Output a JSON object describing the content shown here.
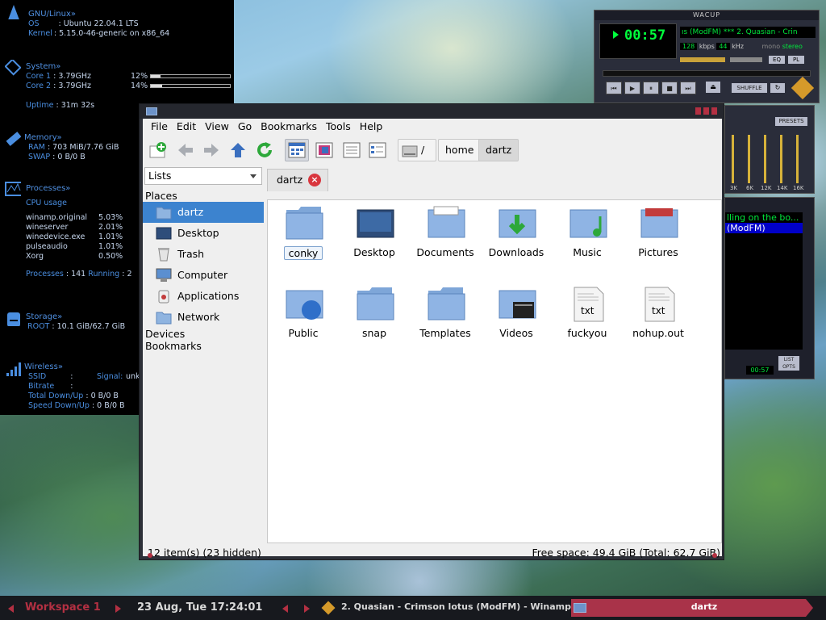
{
  "conky": {
    "sys_header": "GNU/Linux»",
    "os_key": "OS",
    "os_val": ": Ubuntu 22.04.1 LTS",
    "kernel_key": "Kernel",
    "kernel_val": ": 5.15.0-46-generic on x86_64",
    "system_header": "System»",
    "core1_label": "Core 1",
    "core1_val": ": 3.79GHz",
    "core1_pct": "12%",
    "core1_frac": 0.12,
    "core2_label": "Core 2",
    "core2_val": ": 3.79GHz",
    "core2_pct": "14%",
    "core2_frac": 0.14,
    "uptime_label": "Uptime",
    "uptime_val": ": 31m 32s",
    "memory_header": "Memory»",
    "ram_label": "RAM",
    "ram_val": ": 703 MiB/7.76 GiB",
    "swap_label": "SWAP",
    "swap_val": ": 0 B/0 B",
    "processes_header": "Processes»",
    "cpu_usage_label": "CPU usage",
    "procs": [
      {
        "name": "winamp.original",
        "pct": "5.03%"
      },
      {
        "name": "wineserver",
        "pct": "2.01%"
      },
      {
        "name": "winedevice.exe",
        "pct": "1.01%"
      },
      {
        "name": "pulseaudio",
        "pct": "1.01%"
      },
      {
        "name": "Xorg",
        "pct": "0.50%"
      }
    ],
    "processes_label": "Processes",
    "processes_val": ": 141",
    "running_label": "Running",
    "running_val": ": 2",
    "storage_header": "Storage»",
    "root_label": "ROOT",
    "root_val": ": 10.1 GiB/62.7 GiB",
    "wireless_header": "Wireless»",
    "ssid_label": "SSID",
    "ssid_val": ":",
    "signal_label": "Signal:",
    "signal_val": "unk",
    "bitrate_label": "Bitrate",
    "bitrate_val": ":",
    "total_label": "Total Down/Up",
    "total_val": ": 0 B/0 B",
    "speed_label": "Speed Down/Up",
    "speed_val": ": 0 B/0 B"
  },
  "winamp": {
    "title": "WACUP",
    "time": "00:57",
    "scroll_text": "ıs (ModFM) *** 2. Quasian - Crin",
    "kbps": "128",
    "kbps_label": "kbps",
    "khz": "44",
    "khz_label": "kHz",
    "mono_label": "mono",
    "stereo_label": "stereo",
    "eq_btn": "EQ",
    "pl_btn": "PL",
    "shuffle": "SHUFFLE",
    "presets": "PRESETS",
    "eq_bands": [
      "3K",
      "6K",
      "12K",
      "14K",
      "16K"
    ],
    "playlist_item1": "lling on the bo...",
    "playlist_item2": "(ModFM)",
    "playlist_time": "00:57",
    "list_opts": "LIST OPTS"
  },
  "fm": {
    "menu": [
      "File",
      "Edit",
      "View",
      "Go",
      "Bookmarks",
      "Tools",
      "Help"
    ],
    "crumb_root": "/",
    "crumb_home": "home",
    "crumb_cur": "dartz",
    "side_combo": "Lists",
    "places_label": "Places",
    "places": [
      "dartz",
      "Desktop",
      "Trash",
      "Computer",
      "Applications",
      "Network"
    ],
    "devices_label": "Devices",
    "bookmarks_label": "Bookmarks",
    "tab_label": "dartz",
    "files": [
      "conky",
      "Desktop",
      "Documents",
      "Downloads",
      "Music",
      "Pictures",
      "Public",
      "snap",
      "Templates",
      "Videos",
      "fuckyou",
      "nohup.out"
    ],
    "txt_label": "txt",
    "status_left": "12 item(s) (23 hidden)",
    "status_right": "Free space: 49.4 GiB (Total: 62.7 GiB)"
  },
  "panel": {
    "workspace": "Workspace 1",
    "datetime": "23 Aug, Tue 17:24:01",
    "task_winamp": "2. Quasian - Crimson lotus (ModFM) - Winamp",
    "task_fm": "dartz"
  },
  "colors": {
    "accent": "#b33042",
    "conky_text": "#7ab6ff",
    "selection": "#3c83cf"
  }
}
